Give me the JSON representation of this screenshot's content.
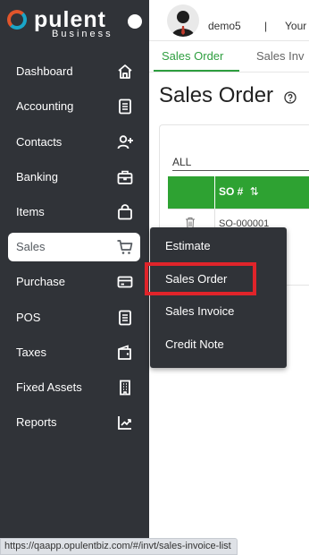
{
  "app": {
    "brand": "opulent",
    "brand_sub": "Business"
  },
  "header": {
    "username": "demo5",
    "separator": "|",
    "right_text": "Your"
  },
  "sidebar": {
    "items": [
      {
        "label": "Dashboard",
        "icon": "home-icon"
      },
      {
        "label": "Accounting",
        "icon": "ledger-icon"
      },
      {
        "label": "Contacts",
        "icon": "add-user-icon"
      },
      {
        "label": "Banking",
        "icon": "briefcase-icon"
      },
      {
        "label": "Items",
        "icon": "bag-icon"
      },
      {
        "label": "Sales",
        "icon": "cart-icon",
        "active": true
      },
      {
        "label": "Purchase",
        "icon": "card-icon"
      },
      {
        "label": "POS",
        "icon": "document-icon"
      },
      {
        "label": "Taxes",
        "icon": "wallet-icon"
      },
      {
        "label": "Fixed Assets",
        "icon": "building-icon"
      },
      {
        "label": "Reports",
        "icon": "trend-chart-icon"
      }
    ]
  },
  "tabs": {
    "active": "Sales Order",
    "inactive": "Sales Inv"
  },
  "main": {
    "title": "Sales Order",
    "filter_value": "ALL",
    "table_header": "SO #",
    "sort_glyph": "⇅",
    "row_value": "SO-000001"
  },
  "submenu": {
    "items": [
      "Estimate",
      "Sales Order",
      "Sales Invoice",
      "Credit Note"
    ],
    "highlighted": "Sales Order"
  },
  "status_bar": {
    "url": "https://qaapp.opulentbiz.com/#/invt/sales-invoice-list"
  },
  "colors": {
    "sidebar_bg": "#303338",
    "accent_green": "#2ea232",
    "tab_green": "#2e9e3f",
    "highlight_red": "#e0242a",
    "logo_orange": "#e0552b",
    "logo_blue": "#1aa6c8"
  }
}
